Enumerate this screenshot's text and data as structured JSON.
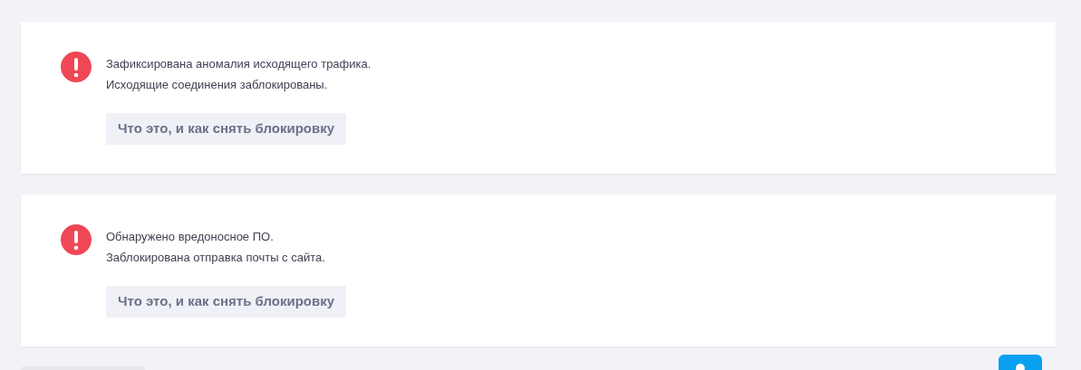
{
  "alerts": [
    {
      "lines": [
        "Зафиксирована аномалия исходящего трафика.",
        "Исходящие соединения заблокированы."
      ],
      "button": "Что это, и как снять блокировку"
    },
    {
      "lines": [
        "Обнаружено вредоносное ПО.",
        "Заблокирована отправка почты с сайта."
      ],
      "button": "Что это, и как снять блокировку"
    }
  ]
}
